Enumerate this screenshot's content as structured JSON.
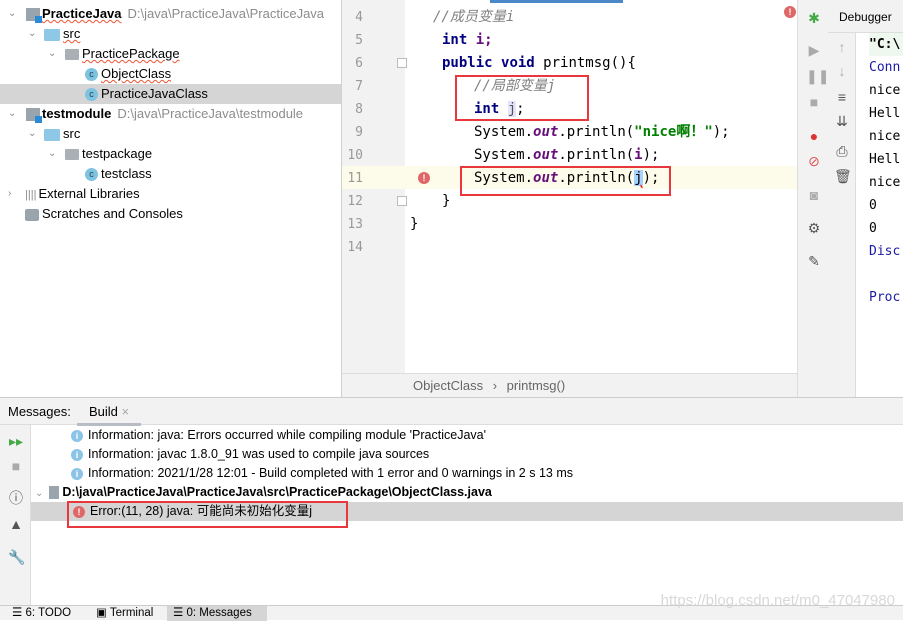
{
  "project_tree": [
    {
      "label": "PracticeJava",
      "path": "D:\\java\\PracticeJava\\PracticeJava",
      "type": "module",
      "expanded": true
    },
    {
      "label": "src",
      "type": "folder",
      "expanded": true
    },
    {
      "label": "PracticePackage",
      "type": "package",
      "expanded": true
    },
    {
      "label": "ObjectClass",
      "type": "class"
    },
    {
      "label": "PracticeJavaClass",
      "type": "runnable-class",
      "selected": true
    },
    {
      "label": "testmodule",
      "path": "D:\\java\\PracticeJava\\testmodule",
      "type": "module",
      "expanded": true
    },
    {
      "label": "src",
      "type": "folder",
      "expanded": true
    },
    {
      "label": "testpackage",
      "type": "package",
      "expanded": true
    },
    {
      "label": "testclass",
      "type": "runnable-class"
    },
    {
      "label": "External Libraries",
      "type": "libraries",
      "expanded": false
    },
    {
      "label": "Scratches and Consoles",
      "type": "scratches"
    }
  ],
  "editor": {
    "line_numbers": [
      "4",
      "5",
      "6",
      "7",
      "8",
      "9",
      "10",
      "11",
      "12",
      "13",
      "14"
    ],
    "lines": {
      "l4": "//成员变量i",
      "l5_kw": "int",
      "l5_rest": " i;",
      "l6_kw1": "public",
      "l6_kw2": "void",
      "l6_rest": " printmsg(){",
      "l7": "//局部变量j",
      "l8_kw": "int",
      "l8_var": "j",
      "l8_end": ";",
      "l9_a": "System.",
      "l9_out": "out",
      "l9_b": ".println(",
      "l9_str": "\"nice啊！\"",
      "l9_c": ");",
      "l10_a": "System.",
      "l10_out": "out",
      "l10_b": ".println(",
      "l10_var": "i",
      "l10_c": ");",
      "l11_a": "System.",
      "l11_out": "out",
      "l11_b": ".println(",
      "l11_var": "j",
      "l11_c": ");",
      "l12": "}",
      "l13": "}"
    },
    "breadcrumb": [
      "ObjectClass",
      "printmsg()"
    ],
    "accent": "#e8383d"
  },
  "debugger": {
    "tab": "Debugger",
    "console": [
      "\"C:\\",
      "Conn",
      "nice",
      "Hell",
      "nice",
      "Hell",
      "nice",
      "0",
      "0",
      "Disc",
      "",
      "Proc"
    ]
  },
  "messages": {
    "label": "Messages:",
    "tab": "Build",
    "rows": [
      {
        "type": "info",
        "text": "Information: java: Errors occurred while compiling module 'PracticeJava'"
      },
      {
        "type": "info",
        "text": "Information: javac 1.8.0_91 was used to compile java sources"
      },
      {
        "type": "info",
        "text": "Information: 2021/1/28 12:01 - Build completed with 1 error and 0 warnings in 2 s 13 ms"
      },
      {
        "type": "file",
        "text": "D:\\java\\PracticeJava\\PracticeJava\\src\\PracticePackage\\ObjectClass.java"
      },
      {
        "type": "error",
        "text": "Error:(11, 28)  java: 可能尚未初始化变量j"
      }
    ]
  },
  "bottom_tabs": [
    "6: TODO",
    "Terminal",
    "0: Messages"
  ],
  "watermark": "https://blog.csdn.net/m0_47047980"
}
